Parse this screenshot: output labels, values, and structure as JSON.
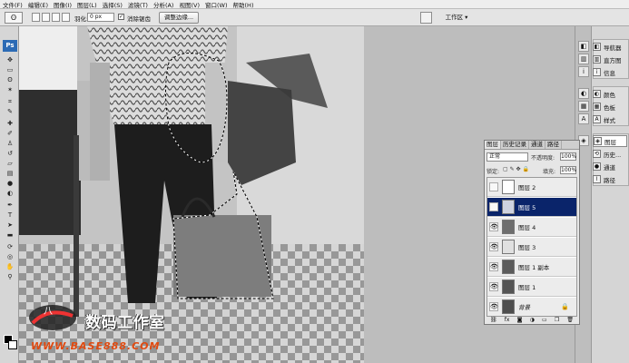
{
  "menu": [
    "文件(F)",
    "编辑(E)",
    "图像(I)",
    "图层(L)",
    "选择(S)",
    "滤镜(T)",
    "分析(A)",
    "视图(V)",
    "窗口(W)",
    "帮助(H)"
  ],
  "options": {
    "feather_label": "羽化:",
    "feather_value": "0 px",
    "antialias_label": "消除锯齿",
    "refine_edge": "调整边缘...",
    "workspace": "工作区 ▾"
  },
  "tools_badge": "Ps",
  "right_panel": {
    "group1": [
      "导航器",
      "直方图",
      "信息"
    ],
    "group2": [
      "颜色",
      "色板",
      "样式"
    ],
    "group3": [
      "图层",
      "历史...",
      "通道",
      "路径"
    ]
  },
  "layers_panel": {
    "tabs": [
      "图层",
      "历史记录",
      "通道",
      "路径"
    ],
    "blend_mode": "正常",
    "opacity_label": "不透明度:",
    "opacity_value": "100%",
    "lock_label": "锁定:",
    "fill_label": "填充:",
    "fill_value": "100%",
    "layers": [
      {
        "name": "图层 2"
      },
      {
        "name": "图层 5"
      },
      {
        "name": "图层 4"
      },
      {
        "name": "图层 3"
      },
      {
        "name": "图层 1 副本"
      },
      {
        "name": "图层 1"
      },
      {
        "name": "背景"
      }
    ]
  },
  "watermark": {
    "title": "数码工作室",
    "url": "WWW.BASE888.COM"
  }
}
